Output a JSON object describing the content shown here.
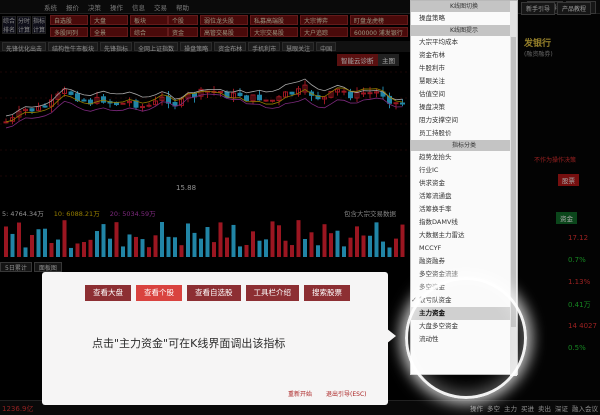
{
  "topbar": {
    "menu": [
      "系统",
      "报价",
      "决策",
      "操作",
      "信息",
      "交易",
      "帮助"
    ],
    "window_buttons": [
      "新手引导",
      "产品教"
    ]
  },
  "left_buttons": [
    "综合排名",
    "分时计算",
    "指标计算"
  ],
  "tool_grid": [
    {
      "label": "自选股"
    },
    {
      "label": "大盘"
    },
    {
      "label": "板块"
    },
    {
      "label": "个股"
    },
    {
      "label": "弱位龙头股"
    },
    {
      "label": "私募高端股"
    },
    {
      "label": "大宗博弈"
    },
    {
      "label": "盯盘龙虎榜"
    },
    {
      "label": "多股同列"
    },
    {
      "label": "全景"
    },
    {
      "label": "综合"
    },
    {
      "label": "资金"
    },
    {
      "label": "高管交易股"
    },
    {
      "label": "大宗交易股"
    },
    {
      "label": "大户追踪"
    },
    {
      "label": "600000 浦发银行"
    }
  ],
  "toolbar2": [
    "先锋优化出击",
    "结构性牛市板块",
    "先锋指标",
    "全网上证指数",
    "操盘策略",
    "资金布林",
    "手机利市",
    "慧眼关注",
    "中国"
  ],
  "chart": {
    "price_label": "15.88",
    "buttons": [
      "智能云诊断",
      "主图"
    ],
    "legend": "包含大宗交易数据"
  },
  "ma_row": [
    {
      "label": "5: 4764.34万",
      "color": "#e0e0e0"
    },
    {
      "label": "10: 6088.21万",
      "color": "#e6c200"
    },
    {
      "label": "20: 5034.59万",
      "color": "#c040c0"
    }
  ],
  "subtabs": [
    "5日累计",
    "面板图"
  ],
  "bottombar": {
    "left": "1236.9亿",
    "right": [
      "操作",
      "多空",
      "主力",
      "买进",
      "卖出",
      "深证",
      "融入会议"
    ]
  },
  "right_panel": {
    "top_buttons": [
      "新手引导",
      "产品教程"
    ],
    "stock": "发银行",
    "stock_sub": "(融资融券)",
    "tags": [
      "股票",
      "资金"
    ],
    "note": "不作为操作决策",
    "values": [
      "17.12",
      "0.7%",
      "1.13%",
      "0.41万",
      "14 4027",
      "0.5%"
    ]
  },
  "menu_panel": {
    "header1": "K线图切换",
    "items1": [
      "操盘策略"
    ],
    "header2": "K线图提示",
    "items2": [
      "大宗平均成本",
      "资金布林",
      "牛股利市",
      "慧眼关注",
      "估值空间",
      "操盘决策",
      "阻力支撑空间",
      "员工持股价"
    ],
    "header3": "指标分类",
    "items3": [
      {
        "label": "趋势龙抬头",
        "state": "normal"
      },
      {
        "label": "行业IC",
        "state": "normal"
      },
      {
        "label": "供求资金",
        "state": "normal"
      },
      {
        "label": "活筹流通盘",
        "state": "normal"
      },
      {
        "label": "活筹换手率",
        "state": "normal"
      },
      {
        "label": "指数DAMV线",
        "state": "normal"
      },
      {
        "label": "大数据主力雷达",
        "state": "normal"
      },
      {
        "label": "MCCYF",
        "state": "normal"
      },
      {
        "label": "融资融券",
        "state": "normal"
      },
      {
        "label": "多空资金流速",
        "state": "normal"
      },
      {
        "label": "多空资金",
        "state": "normal"
      },
      {
        "label": "散亏队资金",
        "state": "checked"
      },
      {
        "label": "主力资金",
        "state": "selected"
      },
      {
        "label": "大盘多空资金",
        "state": "normal"
      },
      {
        "label": "流动性",
        "state": "normal"
      }
    ]
  },
  "dialog": {
    "tabs": [
      {
        "label": "查看大盘",
        "active": false
      },
      {
        "label": "查看个股",
        "active": true
      },
      {
        "label": "查看自选股",
        "active": false
      },
      {
        "label": "工具栏介绍",
        "active": false
      },
      {
        "label": "搜索股票",
        "active": false
      }
    ],
    "message": "点击\"主力资金\"可在K线界面调出该指标",
    "restart": "重新开始",
    "exit": "退出引导(ESC)"
  }
}
